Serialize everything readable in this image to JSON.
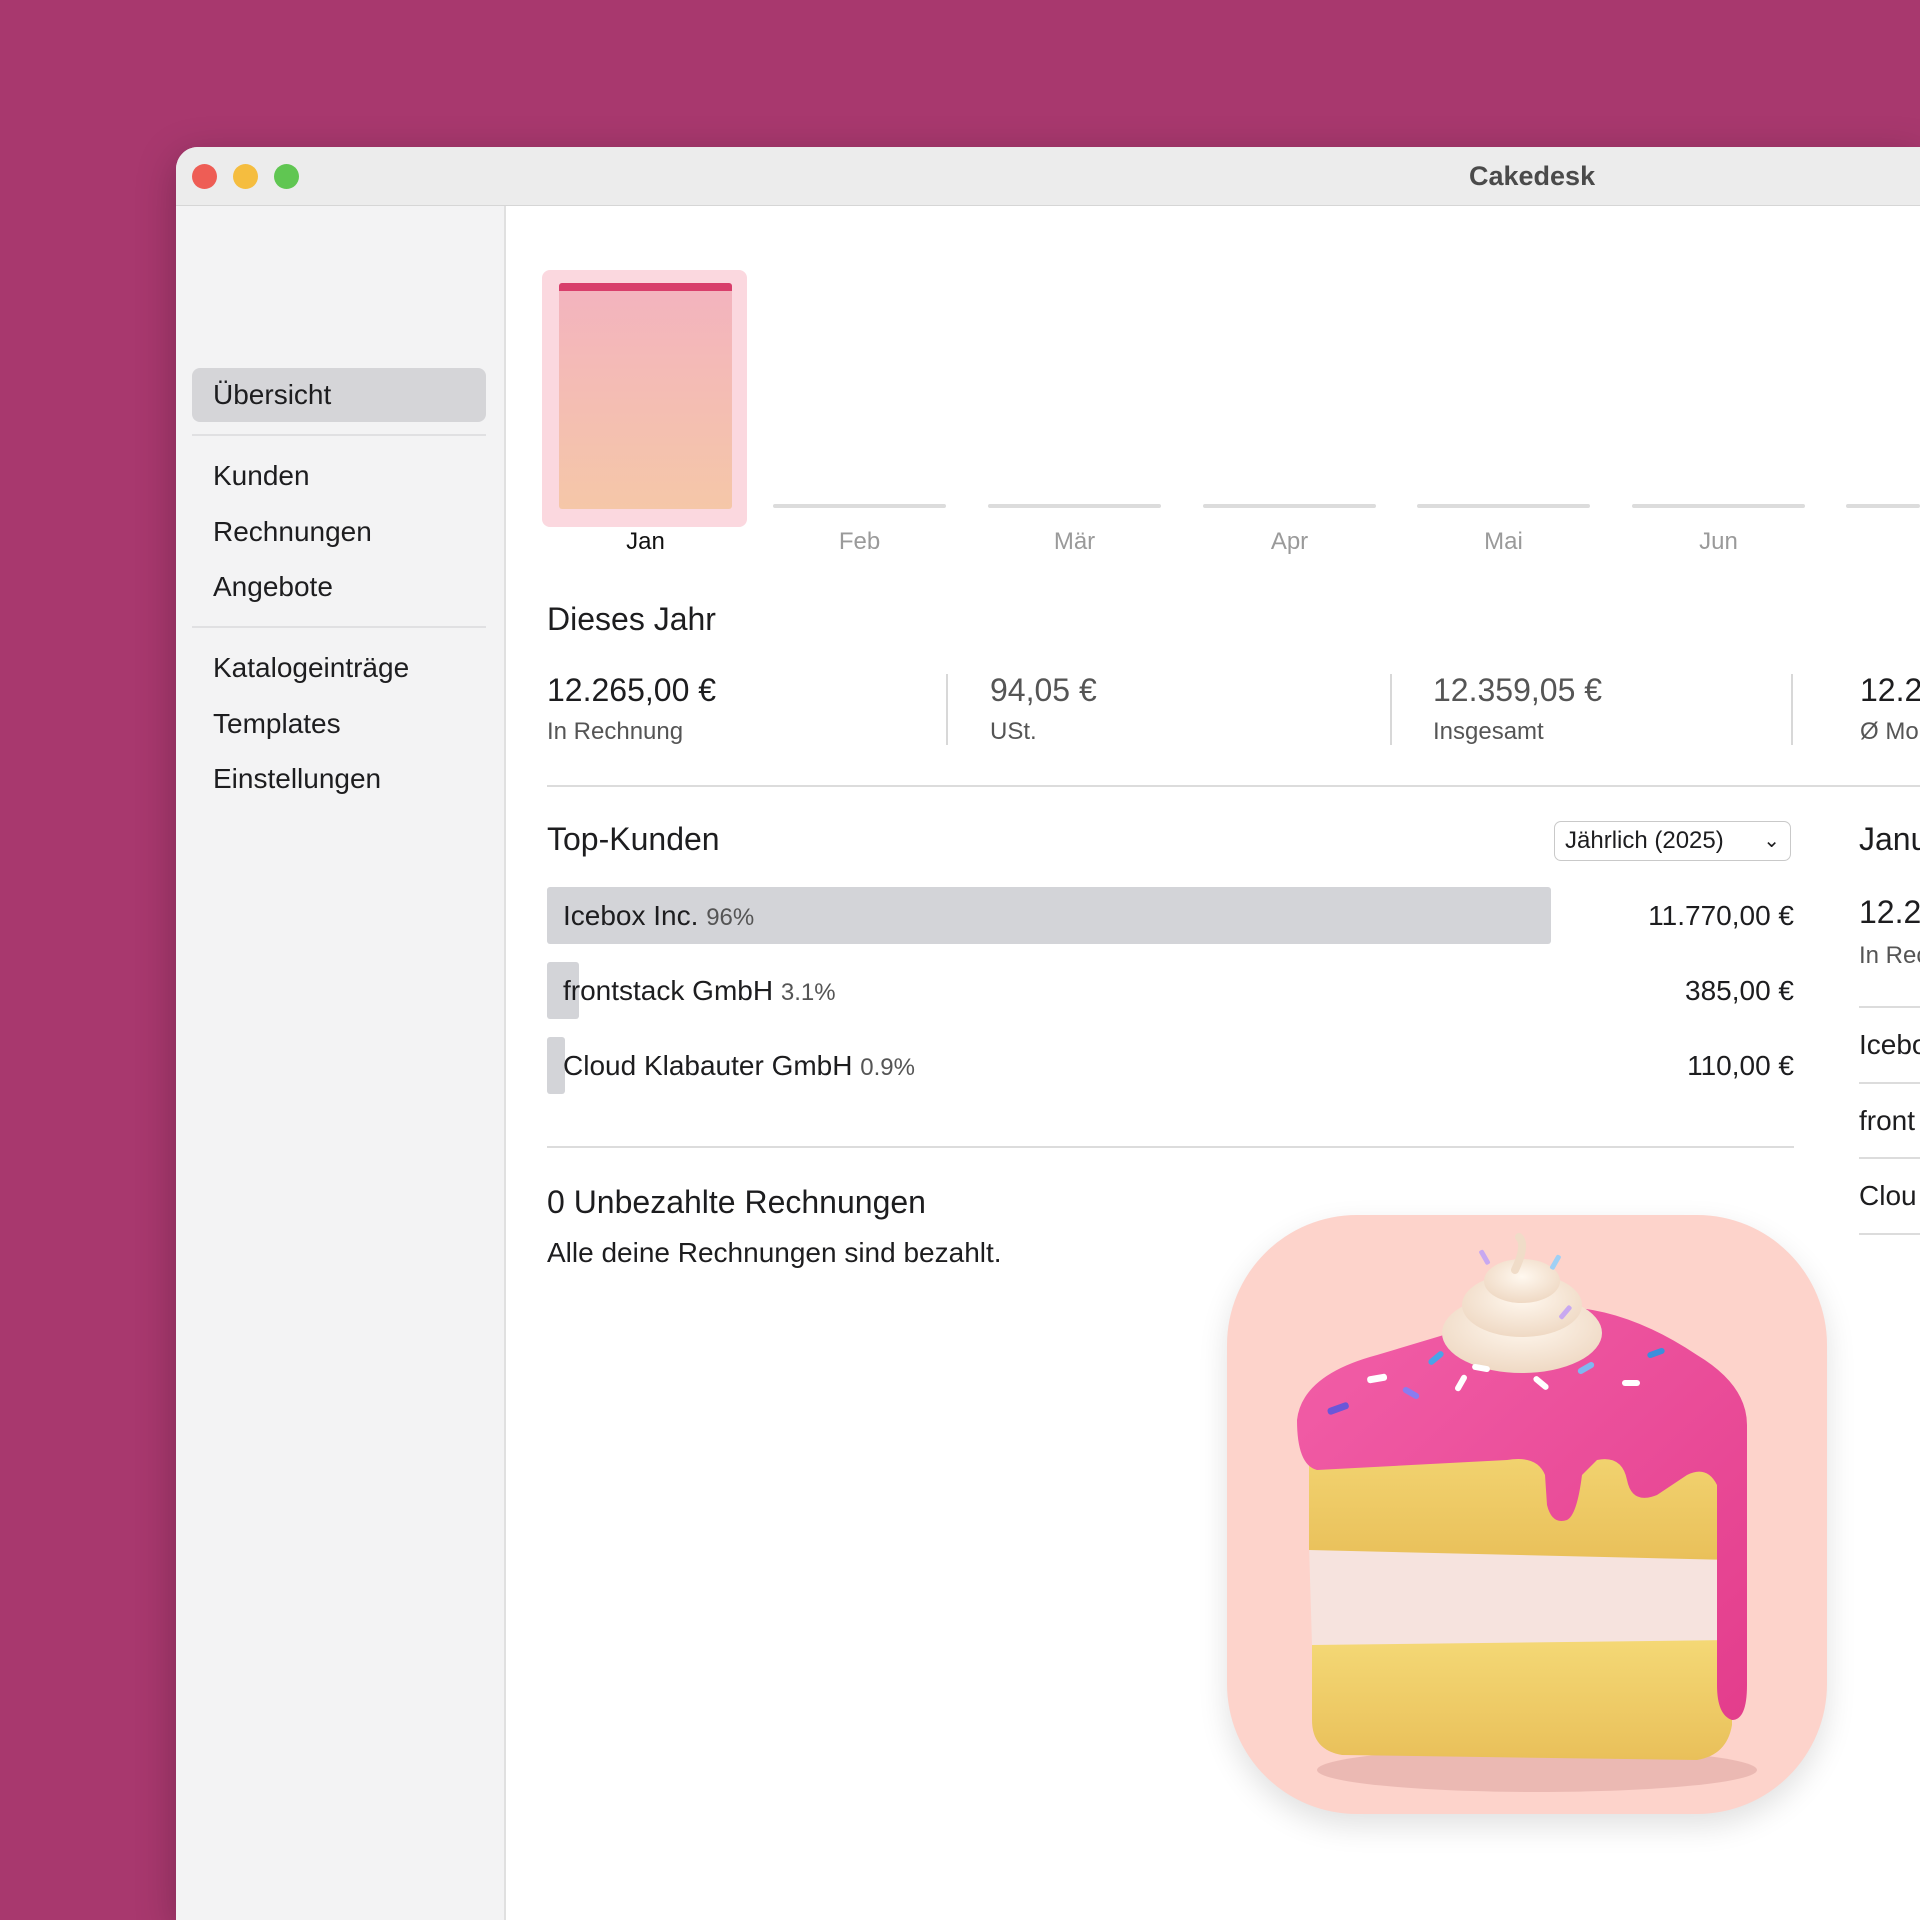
{
  "window": {
    "title": "Cakedesk"
  },
  "sidebar": {
    "items": [
      {
        "label": "Übersicht",
        "active": true
      },
      {
        "label": "Kunden"
      },
      {
        "label": "Rechnungen"
      },
      {
        "label": "Angebote"
      },
      {
        "label": "Katalogeinträge"
      },
      {
        "label": "Templates"
      },
      {
        "label": "Einstellungen"
      }
    ]
  },
  "months": [
    "Jan",
    "Feb",
    "Mär",
    "Apr",
    "Mai",
    "Jun"
  ],
  "chart_data": {
    "type": "bar",
    "categories": [
      "Jan",
      "Feb",
      "Mär",
      "Apr",
      "Mai",
      "Jun"
    ],
    "values": [
      12265,
      0,
      0,
      0,
      0,
      0
    ],
    "selected": "Jan",
    "colors": {
      "fill_top": "#f3b3bf",
      "fill_bottom": "#f5c7a8",
      "cap": "#d83e6b",
      "highlight": "#fbd8df"
    }
  },
  "year": {
    "title": "Dieses Jahr",
    "stats": [
      {
        "value": "12.265,00 €",
        "label": "In Rechnung"
      },
      {
        "value": "94,05 €",
        "label": "USt."
      },
      {
        "value": "12.359,05 €",
        "label": "Insgesamt"
      },
      {
        "value": "12.2",
        "label": "Ø Mo"
      }
    ]
  },
  "top_customers": {
    "title": "Top-Kunden",
    "period": "Jährlich (2025)",
    "rows": [
      {
        "name": "Icebox Inc.",
        "pct": "96%",
        "share": 0.96,
        "amount": "11.770,00 €"
      },
      {
        "name": "frontstack GmbH",
        "pct": "3.1%",
        "share": 0.031,
        "amount": "385,00 €"
      },
      {
        "name": "Cloud Klabauter GmbH",
        "pct": "0.9%",
        "share": 0.009,
        "amount": "110,00 €"
      }
    ]
  },
  "unpaid": {
    "title": "0 Unbezahlte Rechnungen",
    "message": "Alle deine Rechnungen sind bezahlt."
  },
  "month_panel": {
    "title": "Janu",
    "value": "12.2",
    "label": "In Rec",
    "rows": [
      "Icebo",
      "front",
      "Clou"
    ]
  }
}
